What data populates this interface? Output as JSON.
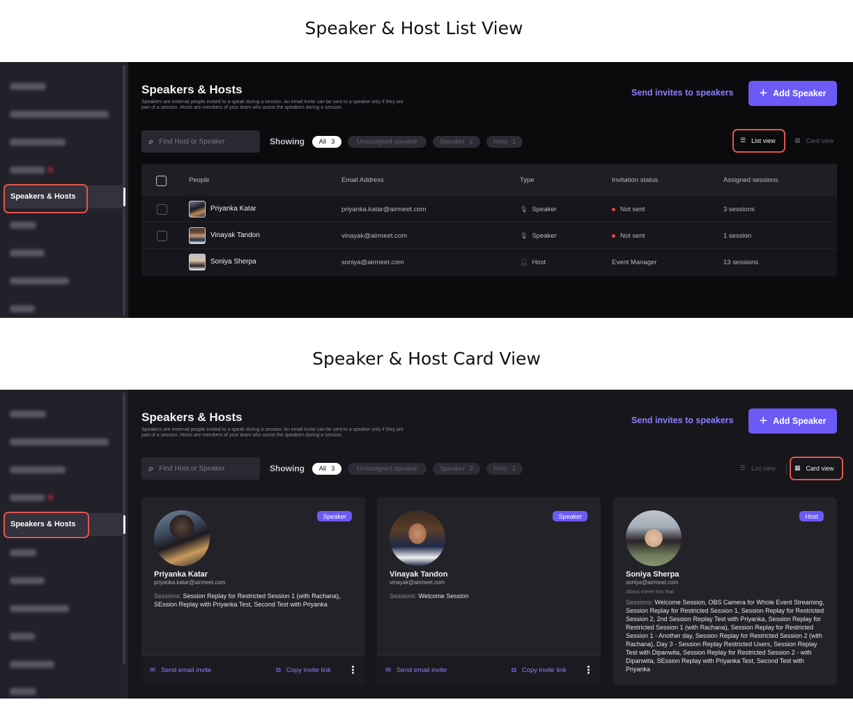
{
  "captions": {
    "list": "Speaker & Host List View",
    "card": "Speaker & Host Card View"
  },
  "sidebar": {
    "active_label": "Speakers & Hosts"
  },
  "header": {
    "title": "Speakers & Hosts",
    "description": "Speakers are external people invited to a speak during a session. An email invite can be sent to a speaker only if they are part of a session. Hosts are members of your team who assist the speakers during a session.",
    "send_invites": "Send invites to speakers",
    "add_speaker": "Add Speaker"
  },
  "filters": {
    "search_placeholder": "Find Host or Speaker",
    "showing_label": "Showing",
    "chips": [
      {
        "label": "All",
        "count": "3"
      },
      {
        "label": "Unassigned speaker",
        "count": ""
      },
      {
        "label": "Speaker",
        "count": "2"
      },
      {
        "label": "Host",
        "count": "1"
      }
    ],
    "list_view": "List view",
    "card_view": "Card view"
  },
  "table": {
    "columns": [
      "People",
      "Email Address",
      "Type",
      "Invitation status",
      "Assigned sessions"
    ],
    "rows": [
      {
        "name": "Priyanka Katar",
        "email": "priyanka.katar@airmeet.com",
        "type": "Speaker",
        "status": "Not sent",
        "sessions": "3 sessions"
      },
      {
        "name": "Vinayak Tandon",
        "email": "vinayak@airmeet.com",
        "type": "Speaker",
        "status": "Not sent",
        "sessions": "1 session"
      },
      {
        "name": "Soniya Sherpa",
        "email": "soniya@airmeet.com",
        "type": "Host",
        "status": "Event Manager",
        "sessions": "13 sessions"
      }
    ]
  },
  "cards": [
    {
      "badge": "Speaker",
      "name": "Priyanka Katar",
      "email": "priyanka.katar@airmeet.com",
      "about": "",
      "sessions_label": "Sessions:",
      "sessions": "Session Replay for Restricted Session 1 (with Rachana), SEssion Replay with Priyanka Test, Second Test with Priyanka",
      "send": "Send email invite",
      "copy": "Copy invite link"
    },
    {
      "badge": "Speaker",
      "name": "Vinayak Tandon",
      "email": "vinayak@airmeet.com",
      "about": "",
      "sessions_label": "Sessions:",
      "sessions": "Welcome Session",
      "send": "Send email invite",
      "copy": "Copy invite link"
    },
    {
      "badge": "Host",
      "name": "Soniya Sherpa",
      "email": "soniya@airmeet.com",
      "about": "About meee this that",
      "sessions_label": "Sessions:",
      "sessions": "Welcome Session, OBS Camera for Whole Event Streaming, Session Replay for Restricted Session 1, Session Replay for Restricted Session 2, 2nd Session Replay Test with Priyanka, Session Replay for Restricted Session 1 (with Rachana), Session Replay for Restricted Session 1 - Another day, Session Replay for Restricted Session 2 (with Rachana), Day 3 - Session Replay Restricted Users, Session Replay Test with Dipanwita, Session Replay for Restricted Session 2 - with Dipanwita, SEssion Replay with Priyanka Test, Second Test with Priyanka"
    }
  ],
  "colors": {
    "accent": "#6c5af6",
    "link": "#8d80ff",
    "highlight": "#e4564e",
    "status_red": "#e5484d"
  }
}
